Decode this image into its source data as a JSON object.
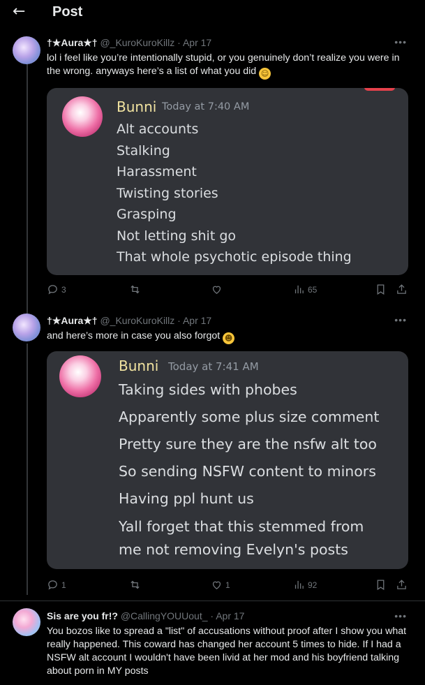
{
  "header": {
    "back_icon": "arrow-left-icon",
    "title": "Post"
  },
  "tweets": [
    {
      "name": "†★Aura★†",
      "handle": "@_KuroKuroKillz",
      "date": "· Apr 17",
      "text": "lol i feel like you’re intentionally stupid, or you genuinely don’t realize you were in the wrong. anyways here’s a list of what you did",
      "emoji": "upside-down-face",
      "card": {
        "user": "Bunni",
        "time": "Today at 7:40 AM",
        "lines": [
          "Alt accounts",
          "Stalking",
          "Harassment",
          "Twisting stories",
          "Grasping",
          "Not letting shit go",
          "That whole psychotic episode thing"
        ]
      },
      "actions": {
        "replies": "3",
        "retweets": "",
        "likes": "",
        "views": "65"
      }
    },
    {
      "name": "†★Aura★†",
      "handle": "@_KuroKuroKillz",
      "date": "· Apr 17",
      "text": "and here’s more in case you also forgot",
      "emoji": "face-savoring-food",
      "card": {
        "user": "Bunni",
        "time": "Today at 7:41 AM",
        "lines": [
          "Taking sides with phobes",
          "Apparently some plus size comment",
          "Pretty sure they are the nsfw alt too",
          "So sending NSFW content to minors",
          "Having ppl hunt us",
          "Yall forget that this stemmed from",
          "me not removing Evelyn's posts"
        ]
      },
      "actions": {
        "replies": "1",
        "retweets": "",
        "likes": "1",
        "views": "92"
      }
    },
    {
      "name": "Sis are you fr!?",
      "handle": "@CallingYOUUout_",
      "date": "· Apr 17",
      "text": "You bozos like to spread a \"list\" of accusations without proof after I show you what really happened. This coward has changed her account 5 times to hide. If I had a NSFW alt account I wouldn't have been livid at her mod and his boyfriend talking about porn in MY posts"
    }
  ],
  "colors": {
    "background": "#000000",
    "card": "#313338",
    "username": "#f1e3a0",
    "muted": "#71767b",
    "alert_tab": "#e5414b"
  }
}
